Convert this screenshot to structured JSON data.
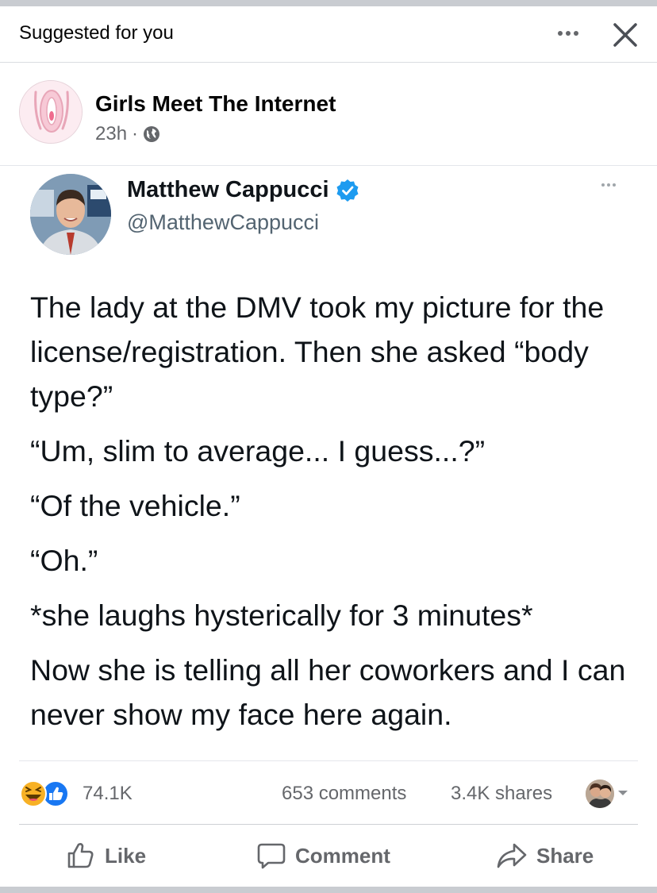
{
  "suggestion": {
    "label": "Suggested for you"
  },
  "post": {
    "page_name": "Girls Meet The Internet",
    "time": "23h",
    "separator": "·",
    "audience_icon": "globe-icon"
  },
  "tweet": {
    "author_name": "Matthew Cappucci",
    "handle": "@MatthewCappucci",
    "verified_icon": "verified-badge-icon",
    "paragraphs": [
      "The lady at the DMV took my picture for the license/registration. Then she asked “body type?”",
      "“Um, slim to average... I guess...?”",
      "“Of the vehicle.”",
      "“Oh.”",
      "*she laughs hysterically for 3 minutes*",
      "Now she is telling all her coworkers and I can never show my face here again."
    ]
  },
  "stats": {
    "reactions": "74.1K",
    "comments": "653 comments",
    "shares": "3.4K shares",
    "reaction_icons": [
      "haha-icon",
      "like-icon"
    ]
  },
  "actions": {
    "like": "Like",
    "comment": "Comment",
    "share": "Share"
  },
  "colors": {
    "secondary_text": "#65676b",
    "like_blue": "#1877f2",
    "verified_blue": "#1d9bf0",
    "haha_yellow": "#f7b125"
  }
}
